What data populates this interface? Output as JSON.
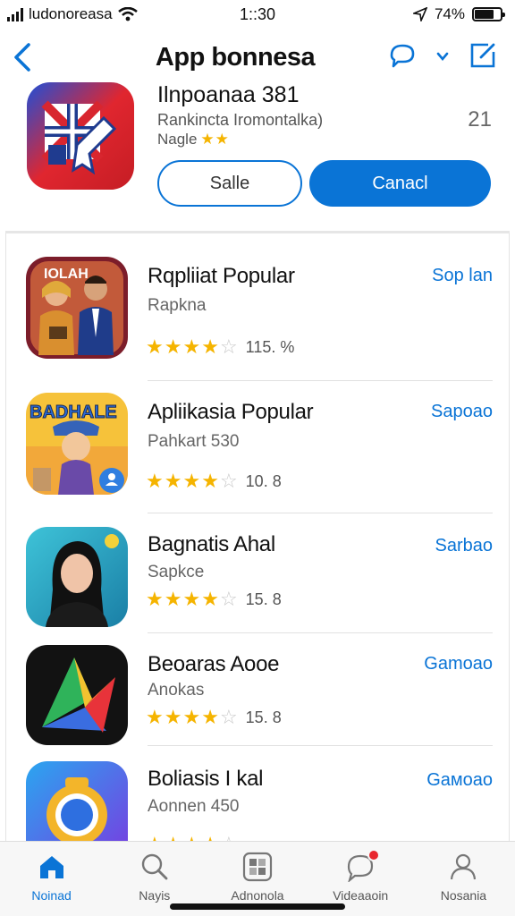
{
  "status_bar": {
    "carrier": "ludonoreasa",
    "time": "1::30",
    "battery": "74%",
    "battery_level": 0.74
  },
  "header": {
    "title": "App bonnesa",
    "back_icon": "chevron-left-icon",
    "icons": [
      "chat-bubble-icon",
      "chevron-down-icon",
      "compose-icon"
    ]
  },
  "featured": {
    "name": "Ilnpoanaa 381",
    "developer": "Rankincta Iromontalka)",
    "rating_label": "Nagle",
    "rating_stars": 2,
    "count": "21",
    "secondary_button": "Salle",
    "primary_button": "Canacl"
  },
  "list": [
    {
      "name": "Rqpliiat Popular",
      "subtitle": "Rapkna",
      "stars": 4,
      "rating": "115. %",
      "action": "Sop lan"
    },
    {
      "name": "Apliikasia Popular",
      "subtitle": "Pahkart 530",
      "stars": 4,
      "rating": "10. 8",
      "action": "Sapoao"
    },
    {
      "name": "Bagnatis Ahal",
      "subtitle": "Sapkce",
      "stars": 4,
      "rating": "15. 8",
      "action": "Sarbao"
    },
    {
      "name": "Beoaras Aooe",
      "subtitle": "Anokas",
      "stars": 4,
      "rating": "15. 8",
      "action": "Gamoao"
    },
    {
      "name": "Boliasis I kal",
      "subtitle": "Aonnen 450",
      "stars": 4,
      "rating": "",
      "action": "Gaмoao"
    }
  ],
  "tabs": [
    {
      "label": "Noinad",
      "icon": "home-icon",
      "active": true
    },
    {
      "label": "Nayis",
      "icon": "search-icon",
      "active": false
    },
    {
      "label": "Adnonola",
      "icon": "grid-icon",
      "active": false
    },
    {
      "label": "Videaaoin",
      "icon": "chat-icon",
      "active": false
    },
    {
      "label": "Nosania",
      "icon": "person-icon",
      "active": false
    }
  ],
  "colors": {
    "accent": "#0a74d6",
    "star": "#f5b400",
    "badge": "#e8262d"
  }
}
